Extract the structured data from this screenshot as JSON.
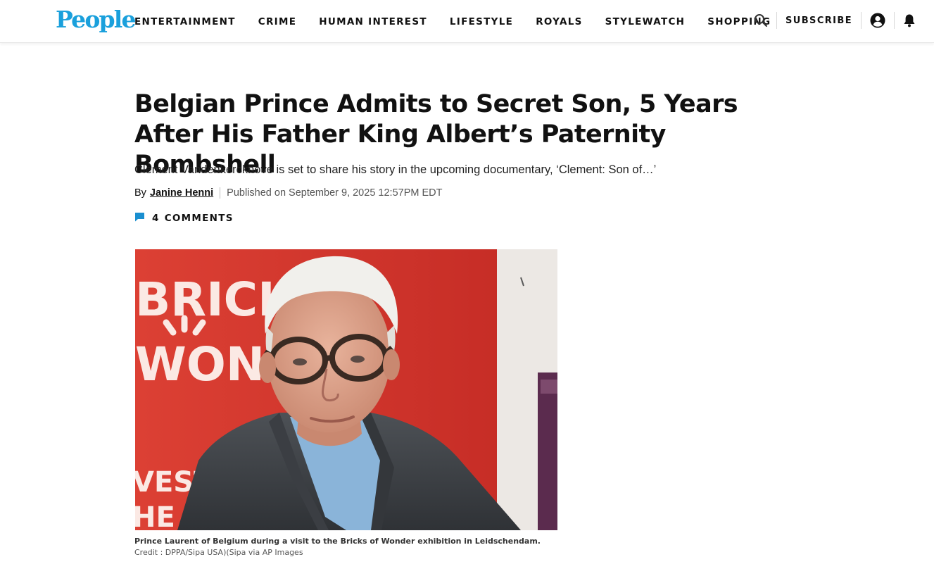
{
  "brand": {
    "logo_text": "People",
    "accent_color": "#1aa0dc",
    "comment_icon_color": "#1a8fd0"
  },
  "nav": {
    "items": [
      {
        "label": "ENTERTAINMENT"
      },
      {
        "label": "CRIME"
      },
      {
        "label": "HUMAN INTEREST"
      },
      {
        "label": "LIFESTYLE"
      },
      {
        "label": "ROYALS"
      },
      {
        "label": "STYLEWATCH"
      },
      {
        "label": "SHOPPING"
      }
    ],
    "subscribe_label": "SUBSCRIBE",
    "icons": [
      "search-icon",
      "account-icon",
      "notification-bell-icon"
    ]
  },
  "article": {
    "headline": "Belgian Prince Admits to Secret Son, 5 Years After His Father King Albert’s Paternity Bombshell",
    "dek": "Clement Vandenkerckhove is set to share his story in the upcoming documentary, ‘Clement: Son of…’",
    "byline_prefix": "By",
    "author": "Janine Henni",
    "published": "Published on September 9, 2025 12:57PM EDT",
    "comments_count": "4",
    "comments_label": "COMMENTS"
  },
  "image": {
    "background_sign_text_1": "BRICKS",
    "background_sign_text_2": "WONDE",
    "background_sign_text_3": "VESTF",
    "background_sign_text_4": "HE N",
    "caption": "Prince Laurent of Belgium during a visit to the Bricks of Wonder exhibition in Leidschendam.",
    "credit": "Credit : DPPA/Sipa USA)(Sipa via AP Images"
  }
}
